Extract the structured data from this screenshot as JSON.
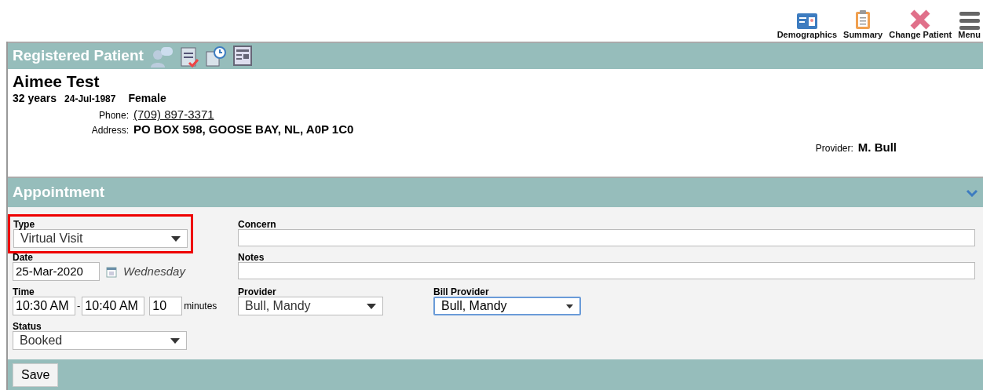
{
  "toolbar": [
    {
      "label": "Demographics",
      "kind": "card"
    },
    {
      "label": "Summary",
      "kind": "clipboard"
    },
    {
      "label": "Change Patient",
      "kind": "cross"
    },
    {
      "label": "Menu",
      "kind": "menu"
    }
  ],
  "patient_panel": {
    "title": "Registered Patient",
    "icons": [
      {
        "kind": "speech"
      },
      {
        "kind": "checklist"
      },
      {
        "kind": "calendar-clock"
      },
      {
        "kind": "form"
      }
    ],
    "name": "Aimee Test",
    "age": "32 years",
    "dob": "24-Jul-1987",
    "sex": "Female",
    "phone_label": "Phone:",
    "phone": "(709) 897-3371",
    "address_label": "Address:",
    "address": "PO BOX 598, GOOSE BAY, NL, A0P 1C0",
    "provider_label": "Provider:",
    "provider": "M. Bull"
  },
  "appointment": {
    "title": "Appointment",
    "expanded": true,
    "type": {
      "label": "Type",
      "value": "Virtual Visit",
      "highlighted": true
    },
    "date": {
      "label": "Date",
      "value": "25-Mar-2020",
      "weekday": "Wednesday"
    },
    "time": {
      "label": "Time",
      "start": "10:30 AM",
      "separator": "-",
      "end": "10:40 AM",
      "duration": "10",
      "unit": "minutes"
    },
    "status": {
      "label": "Status",
      "value": "Booked"
    },
    "concern": {
      "label": "Concern"
    },
    "notes": {
      "label": "Notes"
    },
    "provider": {
      "label": "Provider",
      "value": "Bull, Mandy"
    },
    "bill_provider": {
      "label": "Bill Provider",
      "value": "Bull, Mandy",
      "focused": true
    }
  },
  "buttons": [
    "Save"
  ]
}
